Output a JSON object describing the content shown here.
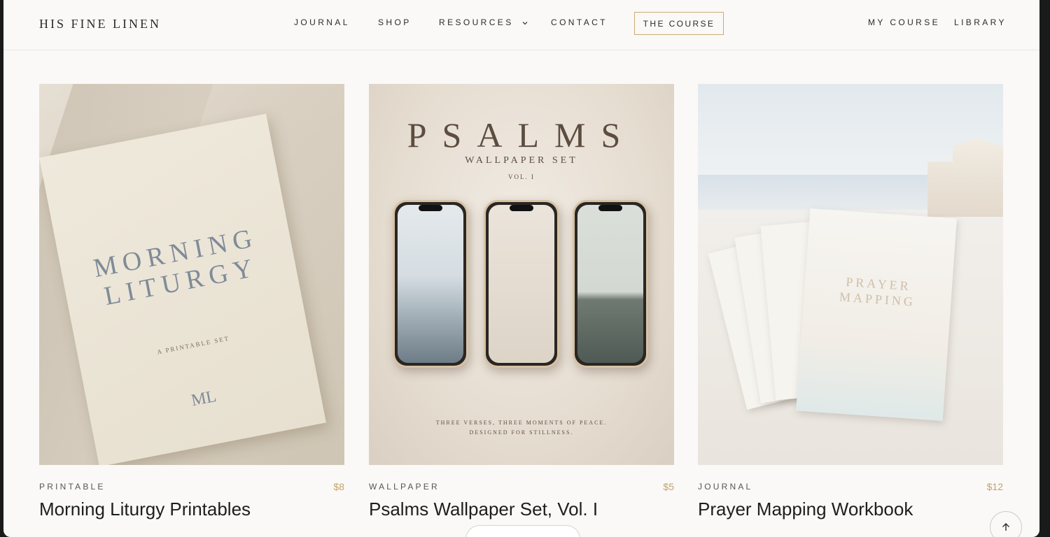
{
  "brand": {
    "logo": "HIS FINE LINEN"
  },
  "nav": {
    "journal": "JOURNAL",
    "shop": "SHOP",
    "resources": "RESOURCES",
    "contact": "CONTACT",
    "course": "THE COURSE",
    "my_course": "MY COURSE",
    "library": "LIBRARY"
  },
  "products": [
    {
      "category": "PRINTABLE",
      "price": "$8",
      "title": "Morning Liturgy Printables",
      "image_text": {
        "title": "MORNING LITURGY",
        "subtitle": "A PRINTABLE SET",
        "monogram": "ML"
      }
    },
    {
      "category": "WALLPAPER",
      "price": "$5",
      "title": "Psalms Wallpaper Set, Vol. I",
      "image_text": {
        "title": "PSALMS",
        "subtitle": "WALLPAPER SET",
        "vol": "VOL. I",
        "footer_line1": "THREE VERSES, THREE MOMENTS OF PEACE.",
        "footer_line2": "DESIGNED FOR STILLNESS."
      }
    },
    {
      "category": "JOURNAL",
      "price": "$12",
      "title": "Prayer Mapping Workbook",
      "image_text": {
        "title": "PRAYER MAPPING"
      }
    }
  ],
  "icons": {
    "resources_chevron": "chevron-down-icon",
    "scroll_top": "arrow-up-icon"
  },
  "colors": {
    "accent": "#c3a36b",
    "background": "#faf9f7",
    "text": "#2b2b2b"
  }
}
